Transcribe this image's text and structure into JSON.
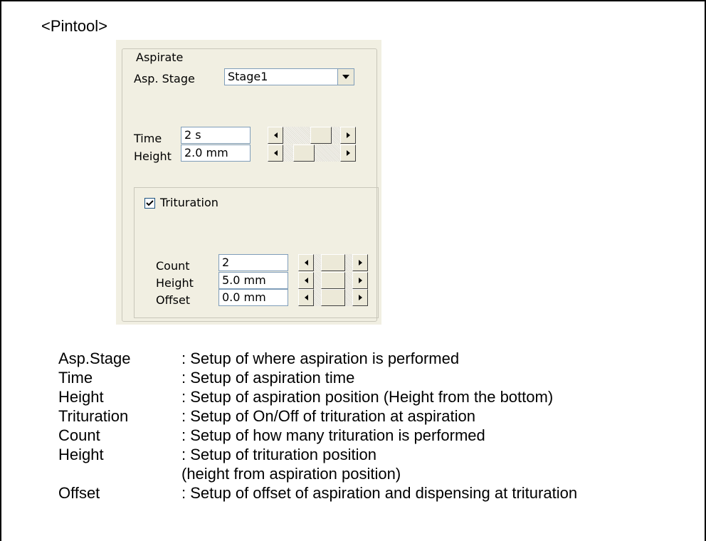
{
  "heading": "<Pintool>",
  "panel": {
    "group_title": "Aspirate",
    "asp_stage": {
      "label": "Asp. Stage",
      "value": "Stage1",
      "icon": "chevron-down-icon"
    },
    "time": {
      "label": "Time",
      "value": "2 s"
    },
    "height": {
      "label": "Height",
      "value": "2.0 mm"
    },
    "trituration": {
      "label": "Trituration",
      "checked": true,
      "count": {
        "label": "Count",
        "value": "2"
      },
      "height": {
        "label": "Height",
        "value": "5.0 mm"
      },
      "offset": {
        "label": "Offset",
        "value": "0.0 mm"
      }
    },
    "colors": {
      "panel_bg": "#f1efe2",
      "input_border": "#7f9db9",
      "group_border": "#c9c7ba"
    }
  },
  "descriptions": [
    {
      "term": "Asp.Stage",
      "text": ": Setup of where aspiration is performed"
    },
    {
      "term": "Time",
      "text": ": Setup of aspiration time"
    },
    {
      "term": "Height",
      "text": ": Setup of aspiration position (Height from the bottom)"
    },
    {
      "term": "Trituration",
      "text": ": Setup of On/Off of trituration at aspiration"
    },
    {
      "term": "Count",
      "text": ": Setup of how many trituration is performed"
    },
    {
      "term": "Height",
      "text": ": Setup of trituration position"
    },
    {
      "term": "",
      "text": " (height from aspiration position)"
    },
    {
      "term": "Offset",
      "text": ": Setup of offset of aspiration and dispensing at trituration"
    }
  ]
}
